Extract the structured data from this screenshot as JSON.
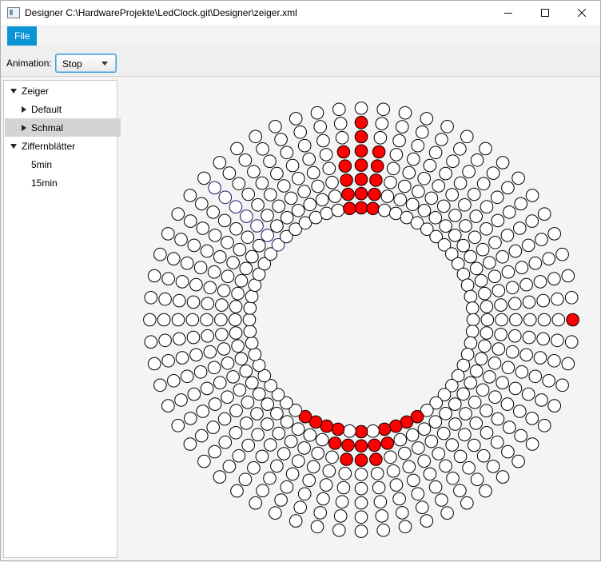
{
  "window": {
    "title": "Designer C:\\HardwareProjekte\\LedClock.git\\Designer\\zeiger.xml",
    "controls": [
      "minimize-icon",
      "maximize-icon",
      "close-icon"
    ]
  },
  "menu": {
    "file": "File"
  },
  "toolbar": {
    "animation_label": "Animation:",
    "animation_value": "Stop"
  },
  "tree": {
    "items": [
      {
        "label": "Zeiger",
        "level": 0,
        "expanded": true
      },
      {
        "label": "Default",
        "level": 1,
        "expanded": false
      },
      {
        "label": "Schmal",
        "level": 1,
        "expanded": false,
        "selected": true
      },
      {
        "label": "Ziffernblätter",
        "level": 0,
        "expanded": true
      },
      {
        "label": "5min",
        "level": 1,
        "leaf": true
      },
      {
        "label": "15min",
        "level": 1,
        "leaf": true
      }
    ]
  },
  "led_ring": {
    "rings": 8,
    "leds_per_ring": 60,
    "lit_color": "#ff0000",
    "unlit_color": "#ffffff",
    "hover_color": "#1a1a66",
    "lit": [
      {
        "angle": 0,
        "rings": [
          0,
          1,
          2,
          3,
          4,
          5,
          6
        ]
      },
      {
        "angle": 1,
        "rings": [
          0,
          1,
          2,
          3,
          4
        ]
      },
      {
        "angle": 59,
        "rings": [
          0,
          1,
          2,
          3,
          4
        ]
      },
      {
        "angle": 15,
        "rings": [
          7
        ]
      },
      {
        "angle": 30,
        "rings": [
          0
        ]
      },
      {
        "angle": 29,
        "rings": [
          1
        ]
      },
      {
        "angle": 31,
        "rings": [
          1
        ]
      },
      {
        "angle": 28,
        "rings": [
          1
        ]
      },
      {
        "angle": 32,
        "rings": [
          1
        ]
      },
      {
        "angle": 33,
        "rings": [
          0
        ]
      },
      {
        "angle": 27,
        "rings": [
          0
        ]
      },
      {
        "angle": 28,
        "rings": [
          0
        ]
      },
      {
        "angle": 32,
        "rings": [
          0
        ]
      },
      {
        "angle": 30,
        "rings": [
          1
        ]
      },
      {
        "angle": 26,
        "rings": [
          0
        ]
      },
      {
        "angle": 34,
        "rings": [
          0
        ]
      },
      {
        "angle": 30,
        "rings": [
          2
        ]
      },
      {
        "angle": 29,
        "rings": [
          2
        ]
      },
      {
        "angle": 31,
        "rings": [
          2
        ]
      },
      {
        "angle": 25,
        "rings": [
          0
        ]
      },
      {
        "angle": 35,
        "rings": [
          0
        ]
      }
    ],
    "hovered": {
      "angle": 52,
      "rings": [
        0,
        1,
        2,
        3,
        4,
        5,
        6
      ]
    }
  }
}
